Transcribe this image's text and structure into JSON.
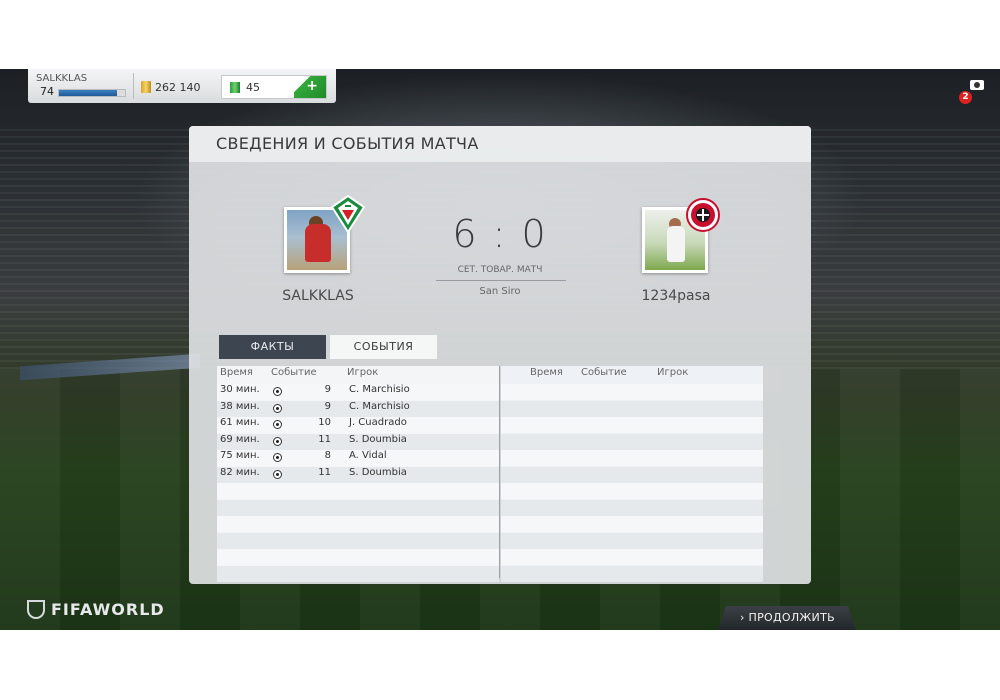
{
  "topbar": {
    "player_name": "SALKKLAS",
    "level": "74",
    "xp_fraction": 0.88,
    "coins": "262 140",
    "points": "45",
    "add_label": "+"
  },
  "notifications": {
    "count": "2"
  },
  "panel": {
    "title": "СВЕДЕНИЯ И СОБЫТИЯ МАТЧА"
  },
  "match": {
    "home_team": "SALKKLAS",
    "away_team": "1234pasa",
    "score": "6 : 0",
    "match_type": "СЕТ. ТОВАР. МАТЧ",
    "stadium": "San Siro"
  },
  "tabs": {
    "facts": "ФАКТЫ",
    "events": "СОБЫТИЯ"
  },
  "events_table": {
    "headers": {
      "time": "Время",
      "event": "Событие",
      "player": "Игрок"
    },
    "home_rows": [
      {
        "time": "30 мин.",
        "event_icon": "goal-ball-icon",
        "number": "9",
        "player": "C. Marchisio"
      },
      {
        "time": "38 мин.",
        "event_icon": "goal-ball-icon",
        "number": "9",
        "player": "C. Marchisio"
      },
      {
        "time": "61 мин.",
        "event_icon": "goal-ball-icon",
        "number": "10",
        "player": "J. Cuadrado"
      },
      {
        "time": "69 мин.",
        "event_icon": "goal-ball-icon",
        "number": "11",
        "player": "S. Doumbia"
      },
      {
        "time": "75 мин.",
        "event_icon": "goal-ball-icon",
        "number": "8",
        "player": "A. Vidal"
      },
      {
        "time": "82 мин.",
        "event_icon": "goal-ball-icon",
        "number": "11",
        "player": "S. Doumbia"
      }
    ],
    "away_rows": []
  },
  "footer": {
    "logo_text": "FIFAWORLD",
    "continue_label": "ПРОДОЛЖИТЬ",
    "continue_icon": "chevron-right-icon"
  },
  "colors": {
    "accent_green": "#34a83a",
    "tab_active": "#3c4550",
    "badge_red": "#dd2222"
  }
}
